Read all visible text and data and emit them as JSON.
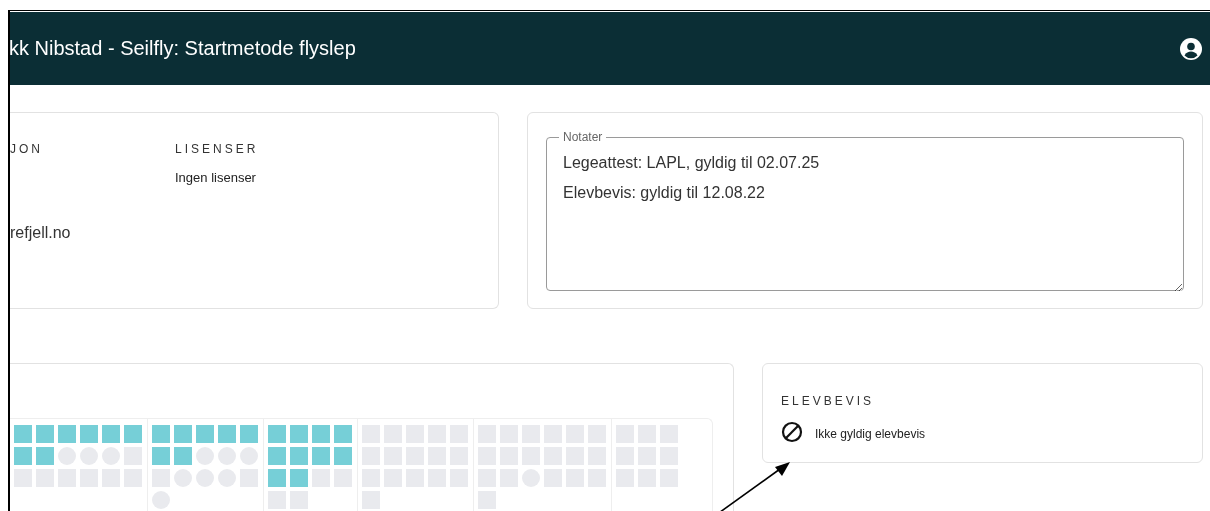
{
  "header": {
    "title": "kk Nibstad - Seilfly: Startmetode flyslep"
  },
  "info": {
    "section_heading": "JON",
    "email": "refjell.no",
    "licenses": {
      "heading": "LISENSER",
      "value": "Ingen lisenser"
    }
  },
  "notes": {
    "legend": "Notater",
    "value": "Legeattest: LAPL, gyldig til 02.07.25\nElevbevis: gyldig til 12.08.22"
  },
  "progress": {
    "groups": [
      {
        "rows": [
          [
            {
              "kind": "done"
            },
            {
              "kind": "done"
            },
            {
              "kind": "done"
            },
            {
              "kind": "done"
            },
            {
              "kind": "done"
            },
            {
              "kind": "done"
            }
          ],
          [
            {
              "kind": "done"
            },
            {
              "kind": "done"
            },
            {
              "kind": "round"
            },
            {
              "kind": "round"
            },
            {
              "kind": "round"
            },
            {
              "kind": "todo"
            }
          ],
          [
            {
              "kind": "todo"
            },
            {
              "kind": "todo"
            },
            {
              "kind": "todo"
            },
            {
              "kind": "todo"
            },
            {
              "kind": "todo"
            },
            {
              "kind": "todo"
            }
          ]
        ]
      },
      {
        "rows": [
          [
            {
              "kind": "done"
            },
            {
              "kind": "done"
            },
            {
              "kind": "done"
            },
            {
              "kind": "done"
            },
            {
              "kind": "done"
            }
          ],
          [
            {
              "kind": "done"
            },
            {
              "kind": "done"
            },
            {
              "kind": "round"
            },
            {
              "kind": "round"
            },
            {
              "kind": "round"
            }
          ],
          [
            {
              "kind": "todo"
            },
            {
              "kind": "round"
            },
            {
              "kind": "round"
            },
            {
              "kind": "round"
            },
            {
              "kind": "todo"
            }
          ],
          [
            {
              "kind": "round"
            }
          ]
        ]
      },
      {
        "rows": [
          [
            {
              "kind": "done"
            },
            {
              "kind": "done"
            },
            {
              "kind": "done"
            },
            {
              "kind": "done"
            }
          ],
          [
            {
              "kind": "done"
            },
            {
              "kind": "done"
            },
            {
              "kind": "done"
            },
            {
              "kind": "done"
            }
          ],
          [
            {
              "kind": "done"
            },
            {
              "kind": "done"
            },
            {
              "kind": "todo"
            },
            {
              "kind": "todo"
            }
          ],
          [
            {
              "kind": "todo"
            },
            {
              "kind": "todo"
            }
          ]
        ]
      },
      {
        "rows": [
          [
            {
              "kind": "todo"
            },
            {
              "kind": "todo"
            },
            {
              "kind": "todo"
            },
            {
              "kind": "todo"
            },
            {
              "kind": "todo"
            }
          ],
          [
            {
              "kind": "todo"
            },
            {
              "kind": "todo"
            },
            {
              "kind": "todo"
            },
            {
              "kind": "todo"
            },
            {
              "kind": "todo"
            }
          ],
          [
            {
              "kind": "todo"
            },
            {
              "kind": "todo"
            },
            {
              "kind": "todo"
            },
            {
              "kind": "todo"
            },
            {
              "kind": "todo"
            }
          ],
          [
            {
              "kind": "todo"
            }
          ]
        ]
      },
      {
        "rows": [
          [
            {
              "kind": "todo"
            },
            {
              "kind": "todo"
            },
            {
              "kind": "todo"
            },
            {
              "kind": "todo"
            },
            {
              "kind": "todo"
            },
            {
              "kind": "todo"
            }
          ],
          [
            {
              "kind": "todo"
            },
            {
              "kind": "todo"
            },
            {
              "kind": "todo"
            },
            {
              "kind": "todo"
            },
            {
              "kind": "todo"
            },
            {
              "kind": "todo"
            }
          ],
          [
            {
              "kind": "todo"
            },
            {
              "kind": "todo"
            },
            {
              "kind": "round"
            },
            {
              "kind": "todo"
            },
            {
              "kind": "todo"
            },
            {
              "kind": "todo"
            }
          ],
          [
            {
              "kind": "todo"
            }
          ]
        ]
      },
      {
        "rows": [
          [
            {
              "kind": "todo"
            },
            {
              "kind": "todo"
            },
            {
              "kind": "todo"
            }
          ],
          [
            {
              "kind": "todo"
            },
            {
              "kind": "todo"
            },
            {
              "kind": "todo"
            }
          ],
          [
            {
              "kind": "todo"
            },
            {
              "kind": "todo"
            },
            {
              "kind": "todo"
            }
          ]
        ]
      }
    ]
  },
  "student_permit": {
    "heading": "ELEVBEVIS",
    "valid": false,
    "status": "Ikke gyldig elevbevis"
  }
}
